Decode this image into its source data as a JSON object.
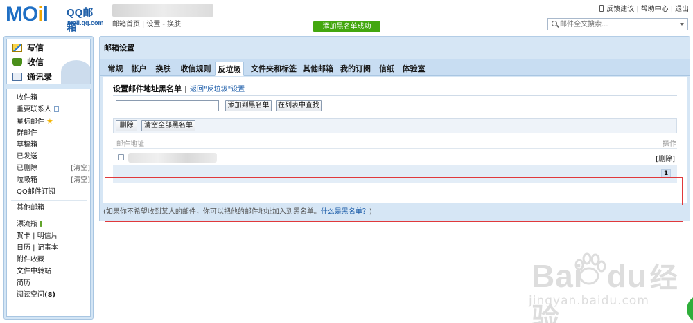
{
  "header": {
    "logo_text": "MOil",
    "logo_title": "QQ邮箱",
    "logo_domain": "mail.qq.com",
    "breadcrumb": [
      "邮箱首页",
      "设置",
      "换肤"
    ],
    "toast": "添加黑名单成功",
    "top_links": [
      "反馈建议",
      "帮助中心",
      "退出"
    ],
    "search_placeholder": "邮件全文搜索..."
  },
  "sidebar": {
    "quick_actions": [
      "写信",
      "收信",
      "通讯录"
    ],
    "folders": [
      {
        "label": "收件箱"
      },
      {
        "label": "重要联系人"
      },
      {
        "label": "星标邮件"
      },
      {
        "label": "群邮件"
      },
      {
        "label": "草稿箱"
      },
      {
        "label": "已发送"
      },
      {
        "label": "已删除",
        "aux": "[清空]"
      },
      {
        "label": "垃圾箱",
        "aux": "[清空]"
      },
      {
        "label": "QQ邮件订阅"
      }
    ],
    "other_mailbox": "其他邮箱",
    "apps": [
      {
        "label": "漂流瓶"
      },
      {
        "label": "贺卡",
        "second": "明信片"
      },
      {
        "label": "日历",
        "second": "记事本"
      },
      {
        "label": "附件收藏"
      },
      {
        "label": "文件中转站"
      },
      {
        "label": "简历"
      },
      {
        "label": "阅读空间",
        "count": "(8)"
      }
    ]
  },
  "main": {
    "title": "邮箱设置",
    "tabs": [
      "常规",
      "帐户",
      "换肤",
      "收信规则",
      "反垃圾",
      "文件夹和标签",
      "其他邮箱",
      "我的订阅",
      "信纸",
      "体验室"
    ],
    "active_tab": "反垃圾",
    "section_title": "设置邮件地址黑名单",
    "separator": "|",
    "back_link": "返回\"反垃圾\"设置",
    "add_button": "添加到黑名单",
    "find_button": "在列表中查找",
    "delete_button": "删除",
    "clear_button": "清空全部黑名单",
    "col_address": "邮件地址",
    "col_ops": "操作",
    "row_delete": "[删除]",
    "page": "1",
    "hint_text": "(如果你不希望收到某人的邮件，你可以把他的邮件地址加入到黑名单。",
    "hint_link": "什么是黑名单？",
    "hint_end": ")"
  },
  "watermark": {
    "brand": "Bai",
    "brand2": "du",
    "cn": "经验",
    "url": "jingyan.baidu.com"
  },
  "colors": {
    "accent": "#1f6fc4",
    "toast_green": "#43a70f",
    "panel_blue": "#d6e6f5",
    "highlight_red": "#e0393c"
  }
}
